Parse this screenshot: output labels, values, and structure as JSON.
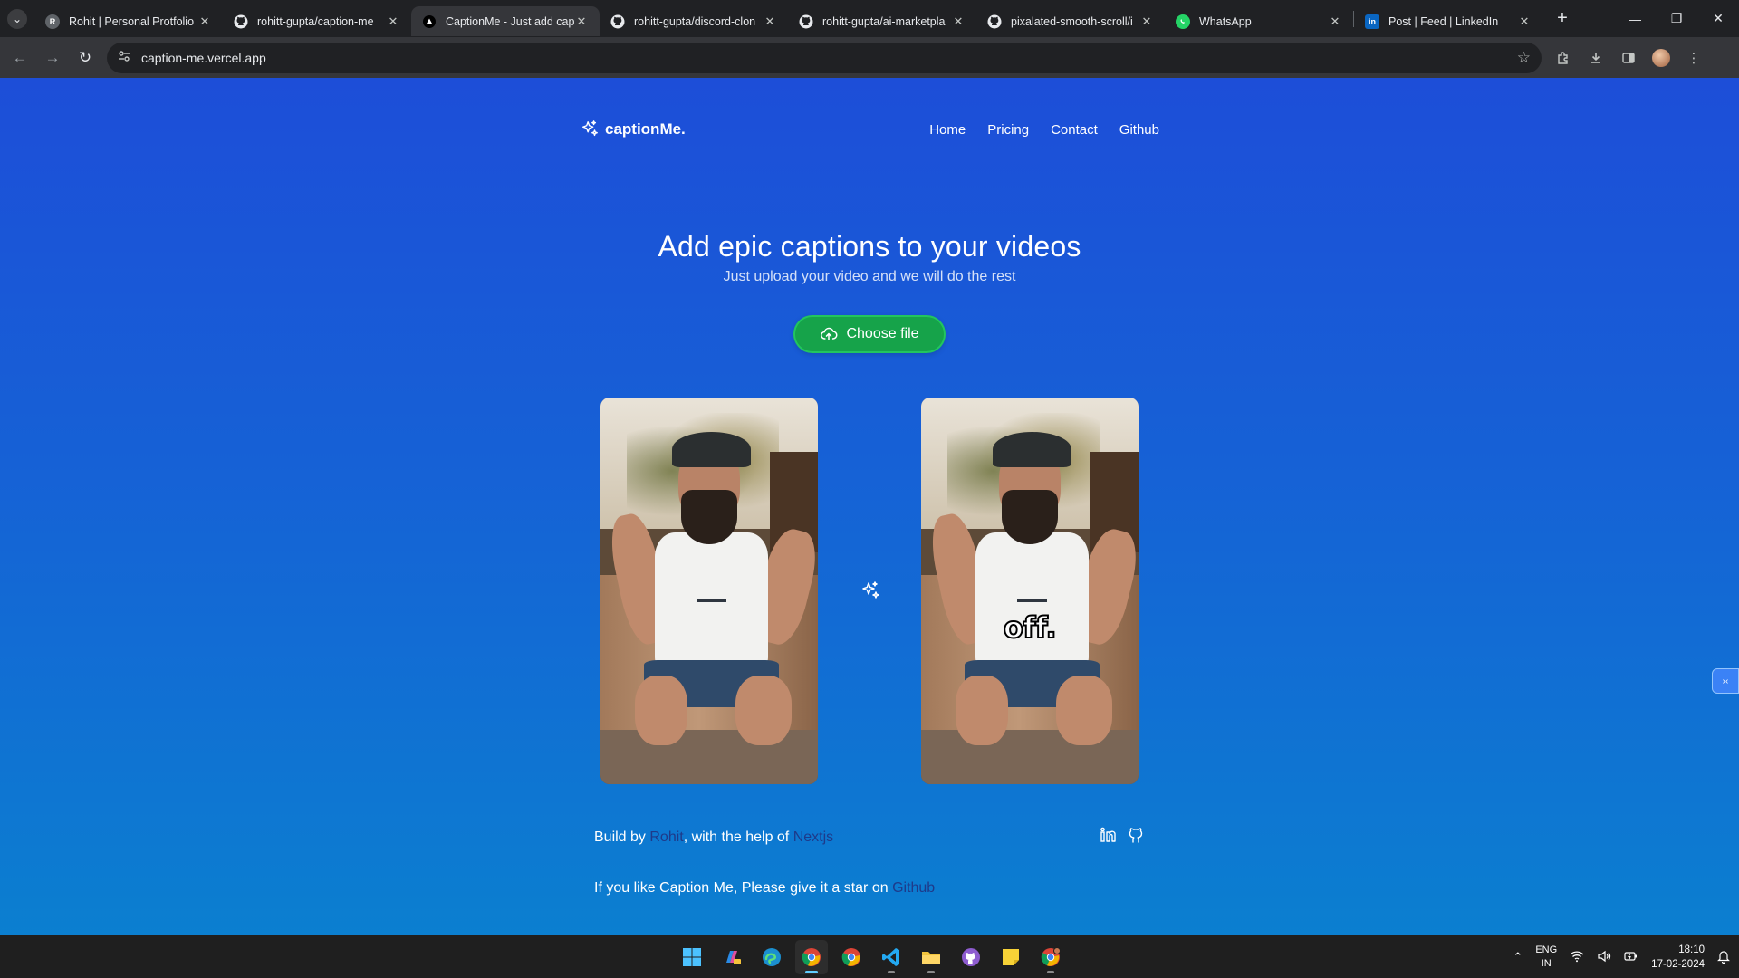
{
  "browser": {
    "tabs": [
      {
        "title": "Rohit | Personal Protfolio",
        "icon": "letter-r-favicon",
        "active": false
      },
      {
        "title": "rohitt-gupta/caption-me",
        "icon": "github-icon",
        "active": false
      },
      {
        "title": "CaptionMe - Just add cap",
        "icon": "vercel-triangle-icon",
        "active": true
      },
      {
        "title": "rohitt-gupta/discord-clon",
        "icon": "github-icon",
        "active": false
      },
      {
        "title": "rohitt-gupta/ai-marketpla",
        "icon": "github-icon",
        "active": false
      },
      {
        "title": "pixalated-smooth-scroll/i",
        "icon": "github-icon",
        "active": false
      },
      {
        "title": "WhatsApp",
        "icon": "whatsapp-icon",
        "active": false
      },
      {
        "title": "Post | Feed | LinkedIn",
        "icon": "linkedin-icon",
        "active": false
      }
    ],
    "url": "caption-me.vercel.app"
  },
  "site": {
    "logo_text": "captionMe.",
    "nav": [
      "Home",
      "Pricing",
      "Contact",
      "Github"
    ],
    "hero_title": "Add epic captions to your videos",
    "hero_subtitle": "Just upload your video and we will do the rest",
    "choose_file_label": "Choose file",
    "caption_word": "off.",
    "footer": {
      "line1_prefix": "Build by ",
      "line1_author": "Rohit",
      "line1_middle": ", with the help of ",
      "line1_tech": "Nextjs",
      "line2_prefix": "If you like Caption Me, Please give it a star on ",
      "line2_link": "Github"
    }
  },
  "taskbar": {
    "lang_top": "ENG",
    "lang_bottom": "IN",
    "time": "18:10",
    "date": "17-02-2024"
  },
  "colors": {
    "page_gradient_top": "#1d4ed8",
    "page_gradient_bottom": "#0b7fd0",
    "button_green": "#16a34a",
    "link_dark_blue": "#1e3a8a"
  }
}
